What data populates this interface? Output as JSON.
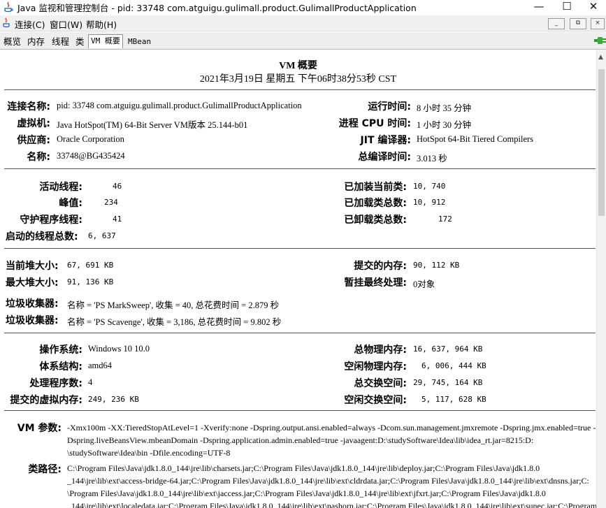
{
  "window": {
    "title": "Java 监视和管理控制台 - pid: 33748 com.atguigu.gulimall.product.GulimallProductApplication",
    "minimize": "—",
    "maximize": "☐",
    "close": "✕"
  },
  "menubar": {
    "items": [
      "连接(C)",
      "窗口(W)",
      "帮助(H)"
    ],
    "mdi_controls": [
      "_",
      "⧉",
      "×"
    ]
  },
  "tabs": [
    "概览",
    "内存",
    "线程",
    "类",
    "VM 概要",
    "MBean"
  ],
  "active_tab": "VM 概要",
  "summary": {
    "title": "VM 概要",
    "datetime": "2021年3月19日 星期五 下午06时38分53秒 CST"
  },
  "vm_info": {
    "connection_label": "连接名称:",
    "connection_value": "pid: 33748 com.atguigu.gulimall.product.GulimallProductApplication",
    "vm_label": "虚拟机:",
    "vm_value": "Java HotSpot(TM) 64-Bit Server VM版本 25.144-b01",
    "vendor_label": "供应商:",
    "vendor_value": "Oracle Corporation",
    "name_label": "名称:",
    "name_value": "33748@BG435424",
    "uptime_label": "运行时间:",
    "uptime_value": "8 小时 35 分钟",
    "cpu_label": "进程 CPU 时间:",
    "cpu_value": "1 小时 30 分钟",
    "jit_label": "JIT 编译器:",
    "jit_value": "HotSpot 64-Bit Tiered Compilers",
    "compile_label": "总编译时间:",
    "compile_value": "3.013 秒"
  },
  "threads": {
    "live_label": "活动线程:",
    "live_value": "46",
    "peak_label": "峰值:",
    "peak_value": "234",
    "daemon_label": "守护程序线程:",
    "daemon_value": "41",
    "started_label": "启动的线程总数:",
    "started_value": "6, 637",
    "loaded_label": "已加装当前类:",
    "loaded_value": "10, 740",
    "total_loaded_label": "已加载类总数:",
    "total_loaded_value": "10, 912",
    "unloaded_label": "已卸载类总数:",
    "unloaded_value": "172"
  },
  "memory": {
    "heap_label": "当前堆大小:",
    "heap_value": "67, 691 KB",
    "max_heap_label": "最大堆大小:",
    "max_heap_value": "91, 136 KB",
    "committed_label": "提交的内存:",
    "committed_value": "90, 112 KB",
    "pending_label": "暂挂最终处理:",
    "pending_value": "0对象",
    "gc1_label": "垃圾收集器:",
    "gc1_value": "名称 = 'PS MarkSweep', 收集 = 40, 总花费时间 = 2.879 秒",
    "gc2_label": "垃圾收集器:",
    "gc2_value": "名称 = 'PS Scavenge', 收集 = 3,186, 总花费时间 = 9.802 秒"
  },
  "os": {
    "os_label": "操作系统:",
    "os_value": "Windows 10 10.0",
    "arch_label": "体系结构:",
    "arch_value": "amd64",
    "cpus_label": "处理程序数:",
    "cpus_value": "4",
    "vmem_label": "提交的虚拟内存:",
    "vmem_value": "249, 236 KB",
    "phys_label": "总物理内存:",
    "phys_value": "16, 637, 964 KB",
    "free_phys_label": "空闲物理内存:",
    "free_phys_value": "6, 006, 444 KB",
    "swap_label": "总交换空间:",
    "swap_value": "29, 745, 164 KB",
    "free_swap_label": "空闲交换空间:",
    "free_swap_value": "5, 117, 628 KB"
  },
  "vm_args": {
    "label": "VM 参数:",
    "lines": [
      "-Xmx100m -XX:TieredStopAtLevel=1 -Xverify:none -Dspring.output.ansi.enabled=always -Dcom.sun.management.jmxremote -Dspring.jmx.enabled=true -",
      "Dspring.liveBeansView.mbeanDomain -Dspring.application.admin.enabled=true -javaagent:D:\\studySoftware\\Idea\\lib\\idea_rt.jar=8215:D:",
      "\\studySoftware\\Idea\\bin -Dfile.encoding=UTF-8"
    ]
  },
  "classpath": {
    "label": "类路径:",
    "lines": [
      "C:\\Program Files\\Java\\jdk1.8.0_144\\jre\\lib\\charsets.jar;C:\\Program Files\\Java\\jdk1.8.0_144\\jre\\lib\\deploy.jar;C:\\Program Files\\Java\\jdk1.8.0",
      "_144\\jre\\lib\\ext\\access-bridge-64.jar;C:\\Program Files\\Java\\jdk1.8.0_144\\jre\\lib\\ext\\cldrdata.jar;C:\\Program Files\\Java\\jdk1.8.0_144\\jre\\lib\\ext\\dnsns.jar;C:",
      "\\Program Files\\Java\\jdk1.8.0_144\\jre\\lib\\ext\\jaccess.jar;C:\\Program Files\\Java\\jdk1.8.0_144\\jre\\lib\\ext\\jfxrt.jar;C:\\Program Files\\Java\\jdk1.8.0",
      "_144\\jre\\lib\\ext\\localedata.jar;C:\\Program Files\\Java\\jdk1.8.0_144\\jre\\lib\\ext\\nashorn.jar;C:\\Program Files\\Java\\jdk1.8.0_144\\jre\\lib\\ext\\sunec.jar;C:\\Program"
    ]
  }
}
